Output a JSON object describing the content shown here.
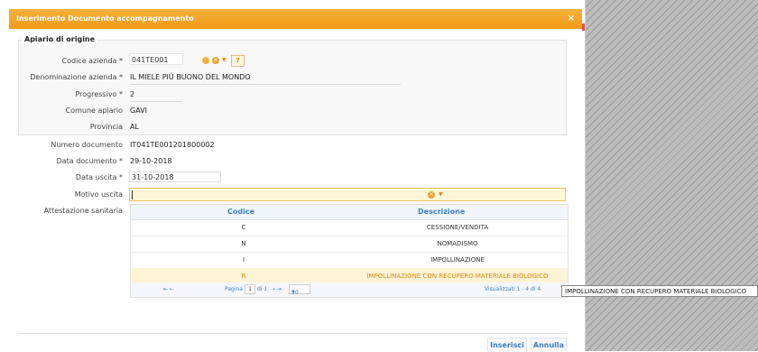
{
  "dialog": {
    "title": "Inserimento Documento accompagnamento",
    "close_glyph": "×"
  },
  "origin": {
    "legend": "Apiario di origine",
    "codice_label": "Codice azienda *",
    "codice_value": "041TE001",
    "help_glyph": "?",
    "denominazione_label": "Denominazione azienda *",
    "denominazione_value": "IL MIELE PIÙ BUONO DEL MONDO",
    "progressivo_label": "Progressivo *",
    "progressivo_value": "2",
    "comune_label": "Comune apiario",
    "comune_value": "GAVI",
    "provincia_label": "Provincia",
    "provincia_value": "AL"
  },
  "document": {
    "numero_label": "Numero documento",
    "numero_value": "IT041TE001201800002",
    "data_doc_label": "Data documento *",
    "data_doc_value": "29-10-2018",
    "data_uscita_label": "Data uscita *",
    "data_uscita_value": "31-10-2018",
    "motivo_label": "Motivo uscita",
    "motivo_value": "",
    "attestazione_label": "Attestazione sanitaria"
  },
  "grid": {
    "col_codice": "Codice",
    "col_descrizione": "Descrizione",
    "rows": [
      {
        "codice": "C",
        "descrizione": "CESSIONE/VENDITA"
      },
      {
        "codice": "N",
        "descrizione": "NOMADISMO"
      },
      {
        "codice": "I",
        "descrizione": "IMPOLLINAZIONE"
      },
      {
        "codice": "R",
        "descrizione": "IMPOLLINAZIONE CON RECUPERO MATERIALE BIOLOGICO"
      }
    ],
    "selected_row": 3,
    "pager": {
      "first_prev": "⇤ ⇠",
      "pagina_label": "Pagina",
      "page_value": "1",
      "di_label": "di 1",
      "next_last": "⇢ ⇥",
      "page_size": "10",
      "visualizzati": "Visualizzati 1 - 4 di 4"
    }
  },
  "tooltip": "IMPOLLINAZIONE CON RECUPERO MATERIALE BIOLOGICO",
  "buttons": {
    "inserisci": "Inserisci",
    "annulla": "Annulla"
  },
  "colors": {
    "accent": "#f5a623",
    "link": "#3b7ec6",
    "selection": "#fff3d6"
  }
}
